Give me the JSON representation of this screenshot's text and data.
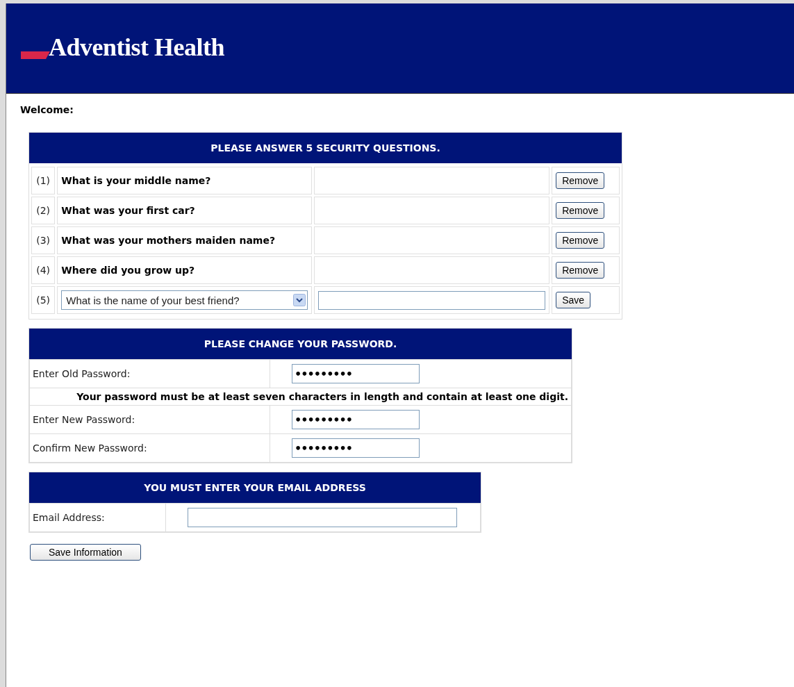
{
  "logo": {
    "text": "Adventist Health"
  },
  "welcome": "Welcome:",
  "security": {
    "title": "PLEASE ANSWER 5 SECURITY QUESTIONS.",
    "questions": [
      {
        "number": "(1)",
        "kind": "answered",
        "question": "What is your middle name?",
        "button": "Remove"
      },
      {
        "number": "(2)",
        "kind": "answered",
        "question": "What was your first car?",
        "button": "Remove"
      },
      {
        "number": "(3)",
        "kind": "answered",
        "question": "What was your mothers maiden name?",
        "button": "Remove"
      },
      {
        "number": "(4)",
        "kind": "answered",
        "question": "Where did you grow up?",
        "button": "Remove"
      },
      {
        "number": "(5)",
        "kind": "new",
        "question": "What is the name of your best friend?",
        "button": "Save"
      }
    ]
  },
  "password": {
    "title": "PLEASE CHANGE YOUR PASSWORD.",
    "rows": [
      {
        "kind": "field",
        "label": "Enter Old Password:",
        "value": "•••••••••"
      },
      {
        "kind": "note",
        "text": "Your password must be at least seven characters in length and contain at least one digit."
      },
      {
        "kind": "field",
        "label": "Enter New Password:",
        "value": "•••••••••"
      },
      {
        "kind": "field",
        "label": "Confirm New Password:",
        "value": "•••••••••"
      }
    ]
  },
  "email": {
    "title": "YOU MUST ENTER YOUR EMAIL ADDRESS",
    "label": "Email Address:"
  },
  "submit": "Save Information"
}
